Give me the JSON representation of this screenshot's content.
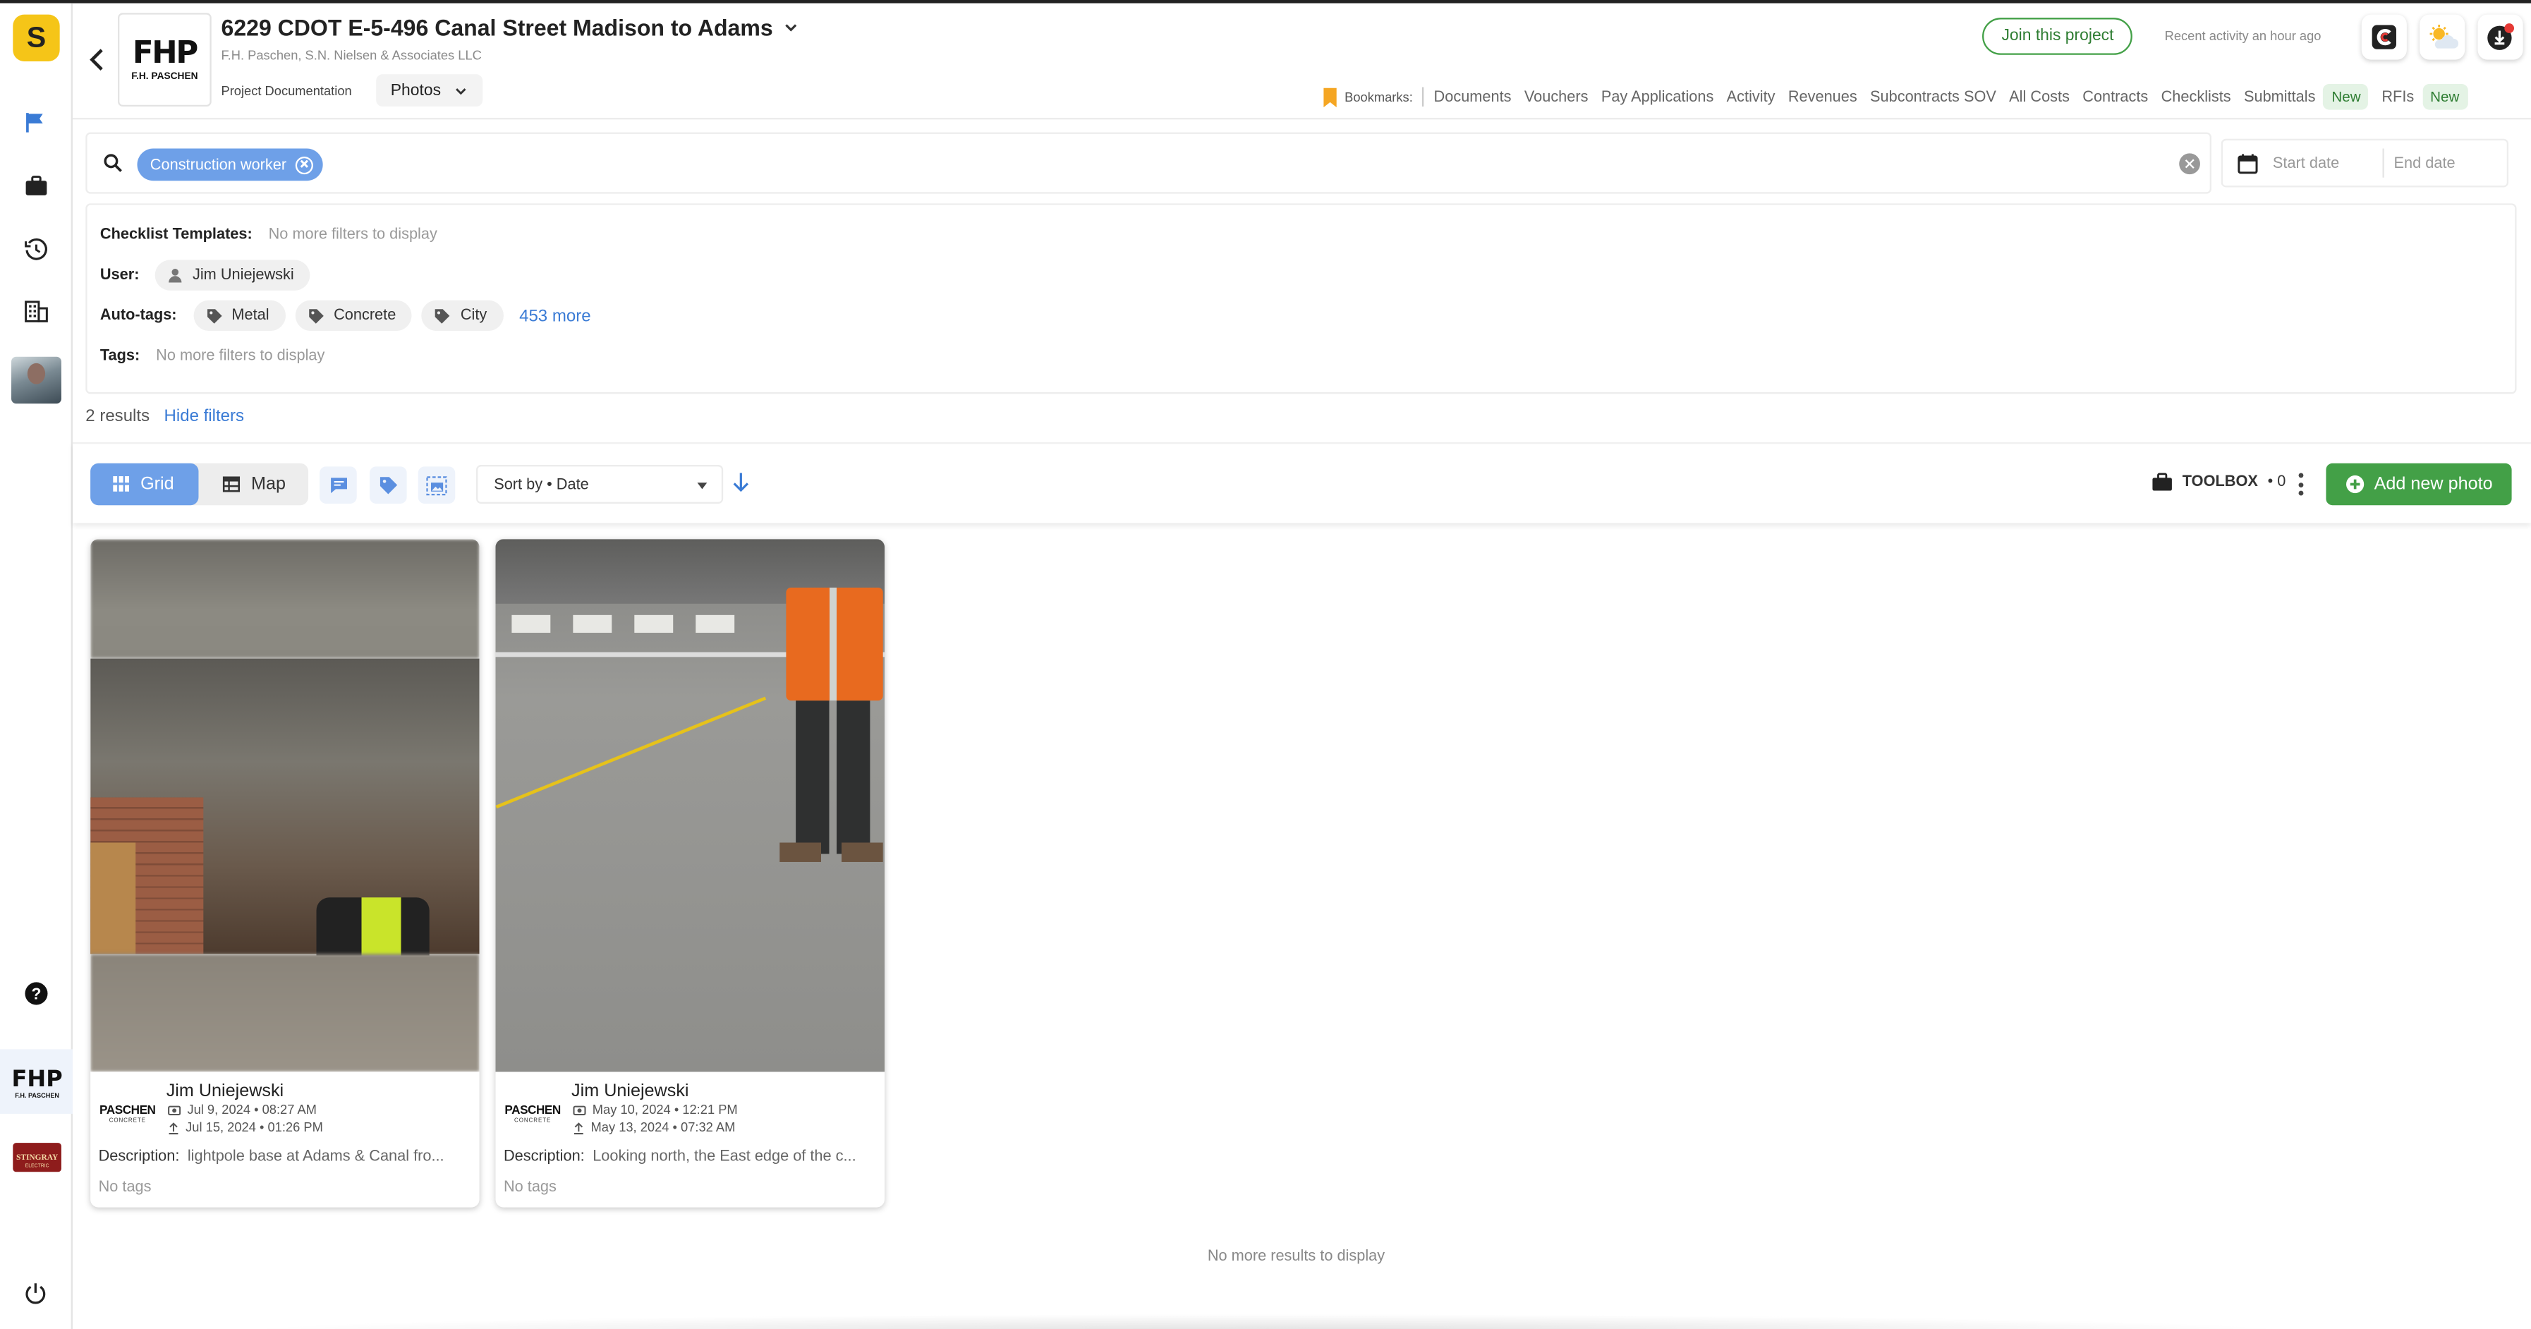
{
  "app": {
    "logo_letter": "S"
  },
  "project": {
    "title": "6229 CDOT E-5-496 Canal Street Madison to Adams",
    "subtitle": "F.H. Paschen, S.N. Nielsen & Associates LLC",
    "logo_mark": "FHP",
    "logo_name": "F.H. PASCHEN",
    "section": "Project Documentation",
    "view_dropdown": "Photos"
  },
  "header": {
    "join_label": "Join this project",
    "recent_activity": "Recent activity an hour ago"
  },
  "bookmarks": {
    "label": "Bookmarks:",
    "links": [
      "Documents",
      "Vouchers",
      "Pay Applications",
      "Activity",
      "Revenues",
      "Subcontracts SOV",
      "All Costs",
      "Contracts",
      "Checklists"
    ],
    "submittals": "Submittals",
    "rfis": "RFIs",
    "new_badge": "New"
  },
  "search": {
    "chip": "Construction worker",
    "start_placeholder": "Start date",
    "end_placeholder": "End date"
  },
  "filters": {
    "checklist_label": "Checklist Templates:",
    "checklist_value": "No more filters to display",
    "user_label": "User:",
    "user_chip": "Jim Uniejewski",
    "autotags_label": "Auto-tags:",
    "autotags": [
      "Metal",
      "Concrete",
      "City"
    ],
    "autotags_more": "453 more",
    "tags_label": "Tags:",
    "tags_value": "No more filters to display"
  },
  "results": {
    "count": "2 results",
    "hide": "Hide filters"
  },
  "toolbar": {
    "grid": "Grid",
    "map": "Map",
    "sort": "Sort by • Date",
    "toolbox": "TOOLBOX",
    "toolbox_count": "• 0",
    "add": "Add new photo"
  },
  "photos": [
    {
      "author": "Jim Uniejewski",
      "company_logo": "PASCHEN",
      "company_logo_sub": "CONCRETE",
      "taken": "Jul 9, 2024 • 08:27 AM",
      "uploaded": "Jul 15, 2024 • 01:26 PM",
      "description_label": "Description:",
      "description": "lightpole base at Adams & Canal fro...",
      "tags": "No tags"
    },
    {
      "author": "Jim Uniejewski",
      "company_logo": "PASCHEN",
      "company_logo_sub": "CONCRETE",
      "taken": "May 10, 2024 • 12:21 PM",
      "uploaded": "May 13, 2024 • 07:32 AM",
      "description_label": "Description:",
      "description": "Looking north, the East edge of the c...",
      "tags": "No tags"
    }
  ],
  "footer": {
    "no_more": "No more results to display"
  },
  "colors": {
    "accent": "#6ea0e8",
    "primary_green": "#43a047",
    "brand_yellow": "#f5c518",
    "link": "#3a7bd5"
  }
}
